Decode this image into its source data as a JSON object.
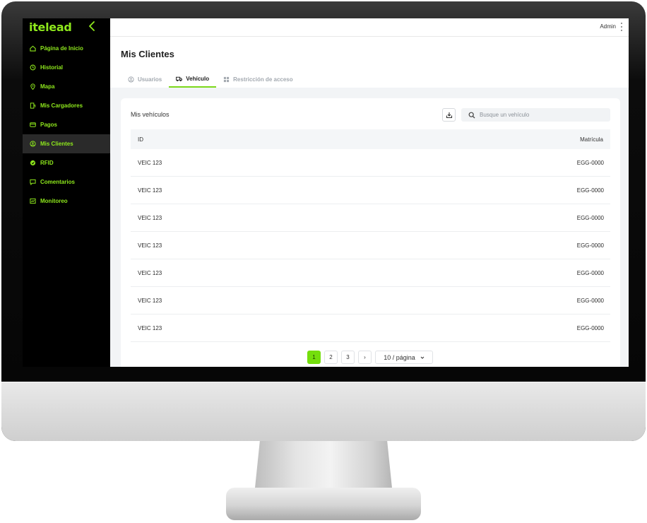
{
  "brand": {
    "logo_text": "itelead",
    "accent": "#8ee81c"
  },
  "sidebar": {
    "items": [
      {
        "label": "Página de Inicio",
        "icon": "home-icon"
      },
      {
        "label": "Historial",
        "icon": "history-icon"
      },
      {
        "label": "Mapa",
        "icon": "map-pin-icon"
      },
      {
        "label": "Mis Cargadores",
        "icon": "charger-icon"
      },
      {
        "label": "Pagos",
        "icon": "credit-card-icon"
      },
      {
        "label": "Mis Clientes",
        "icon": "user-circle-icon",
        "active": true
      },
      {
        "label": "RFID",
        "icon": "rfid-icon"
      },
      {
        "label": "Comentarios",
        "icon": "comment-icon"
      },
      {
        "label": "Monitoreo",
        "icon": "monitor-icon"
      }
    ]
  },
  "header": {
    "user": "Admin"
  },
  "page": {
    "title": "Mis Clientes",
    "tabs": [
      {
        "label": "Usuarios",
        "icon": "user-circle-icon"
      },
      {
        "label": "Vehículo",
        "icon": "truck-icon",
        "active": true
      },
      {
        "label": "Restricción de acceso",
        "icon": "grid-icon"
      }
    ]
  },
  "card": {
    "title": "Mis vehículos",
    "search_placeholder": "Busque un vehículo",
    "columns": [
      "ID",
      "Matrícula"
    ],
    "rows": [
      [
        "VEIC 123",
        "EGG-0000"
      ],
      [
        "VEIC 123",
        "EGG-0000"
      ],
      [
        "VEIC 123",
        "EGG-0000"
      ],
      [
        "VEIC 123",
        "EGG-0000"
      ],
      [
        "VEIC 123",
        "EGG-0000"
      ],
      [
        "VEIC 123",
        "EGG-0000"
      ],
      [
        "VEIC 123",
        "EGG-0000"
      ]
    ]
  },
  "pagination": {
    "pages": [
      "1",
      "2",
      "3"
    ],
    "current": "1",
    "next_symbol": "›",
    "page_size": "10 / página"
  }
}
